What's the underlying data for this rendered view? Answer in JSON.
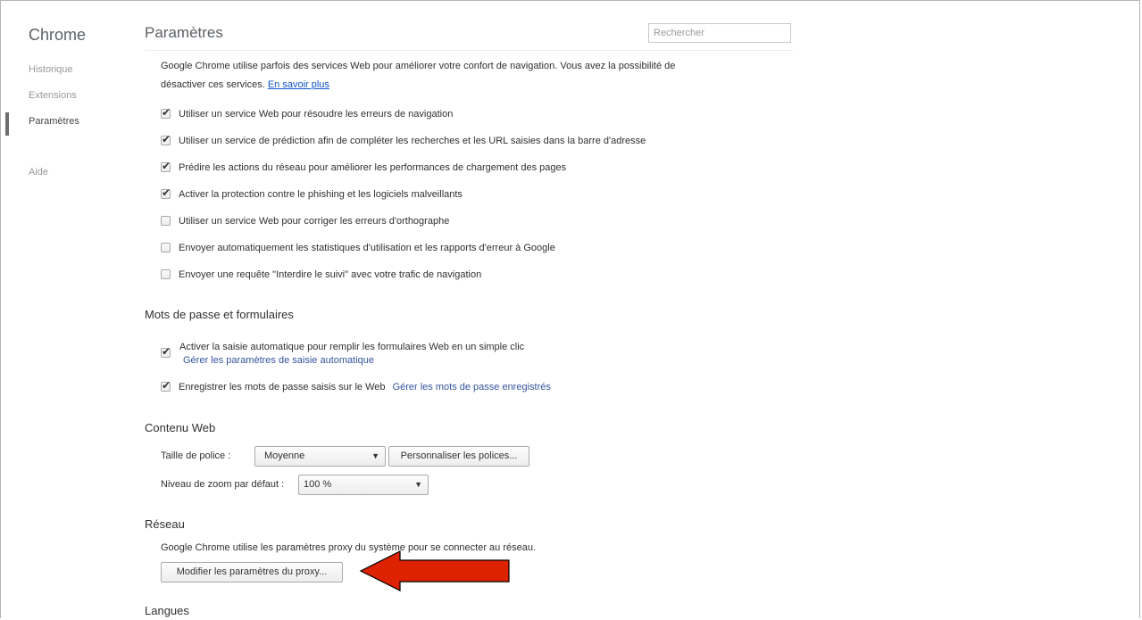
{
  "sidebar": {
    "app_title": "Chrome",
    "items": [
      {
        "label": "Historique"
      },
      {
        "label": "Extensions"
      },
      {
        "label": "Paramètres"
      },
      {
        "label": "Aide"
      }
    ]
  },
  "header": {
    "title": "Paramètres",
    "search_placeholder": "Rechercher"
  },
  "privacy": {
    "intro": "Google Chrome utilise parfois des services Web pour améliorer votre confort de navigation. Vous avez la possibilité de désactiver ces services.",
    "learn_more": "En savoir plus",
    "options": [
      {
        "label": "Utiliser un service Web pour résoudre les erreurs de navigation",
        "checked": true
      },
      {
        "label": "Utiliser un service de prédiction afin de compléter les recherches et les URL saisies dans la barre d'adresse",
        "checked": true
      },
      {
        "label": "Prédire les actions du réseau pour améliorer les performances de chargement des pages",
        "checked": true
      },
      {
        "label": "Activer la protection contre le phishing et les logiciels malveillants",
        "checked": true
      },
      {
        "label": "Utiliser un service Web pour corriger les erreurs d'orthographe",
        "checked": false
      },
      {
        "label": "Envoyer automatiquement les statistiques d'utilisation et les rapports d'erreur à Google",
        "checked": false
      },
      {
        "label": "Envoyer une requête \"Interdire le suivi\" avec votre trafic de navigation",
        "checked": false
      }
    ]
  },
  "passwords": {
    "title": "Mots de passe et formulaires",
    "autofill_label": "Activer la saisie automatique pour remplir les formulaires Web en un simple clic",
    "autofill_link": "Gérer les paramètres de saisie automatique",
    "save_label": "Enregistrer les mots de passe saisis sur le Web",
    "save_link": "Gérer les mots de passe enregistrés"
  },
  "web_content": {
    "title": "Contenu Web",
    "font_size_label": "Taille de police :",
    "font_size_value": "Moyenne",
    "customize_fonts": "Personnaliser les polices...",
    "zoom_label": "Niveau de zoom par défaut :",
    "zoom_value": "100 %"
  },
  "network": {
    "title": "Réseau",
    "description": "Google Chrome utilise les paramètres proxy du système pour se connecter au réseau.",
    "proxy_button": "Modifier les paramètres du proxy..."
  },
  "languages": {
    "title": "Langues"
  },
  "annotation": {
    "arrow_color": "#dd2200"
  }
}
